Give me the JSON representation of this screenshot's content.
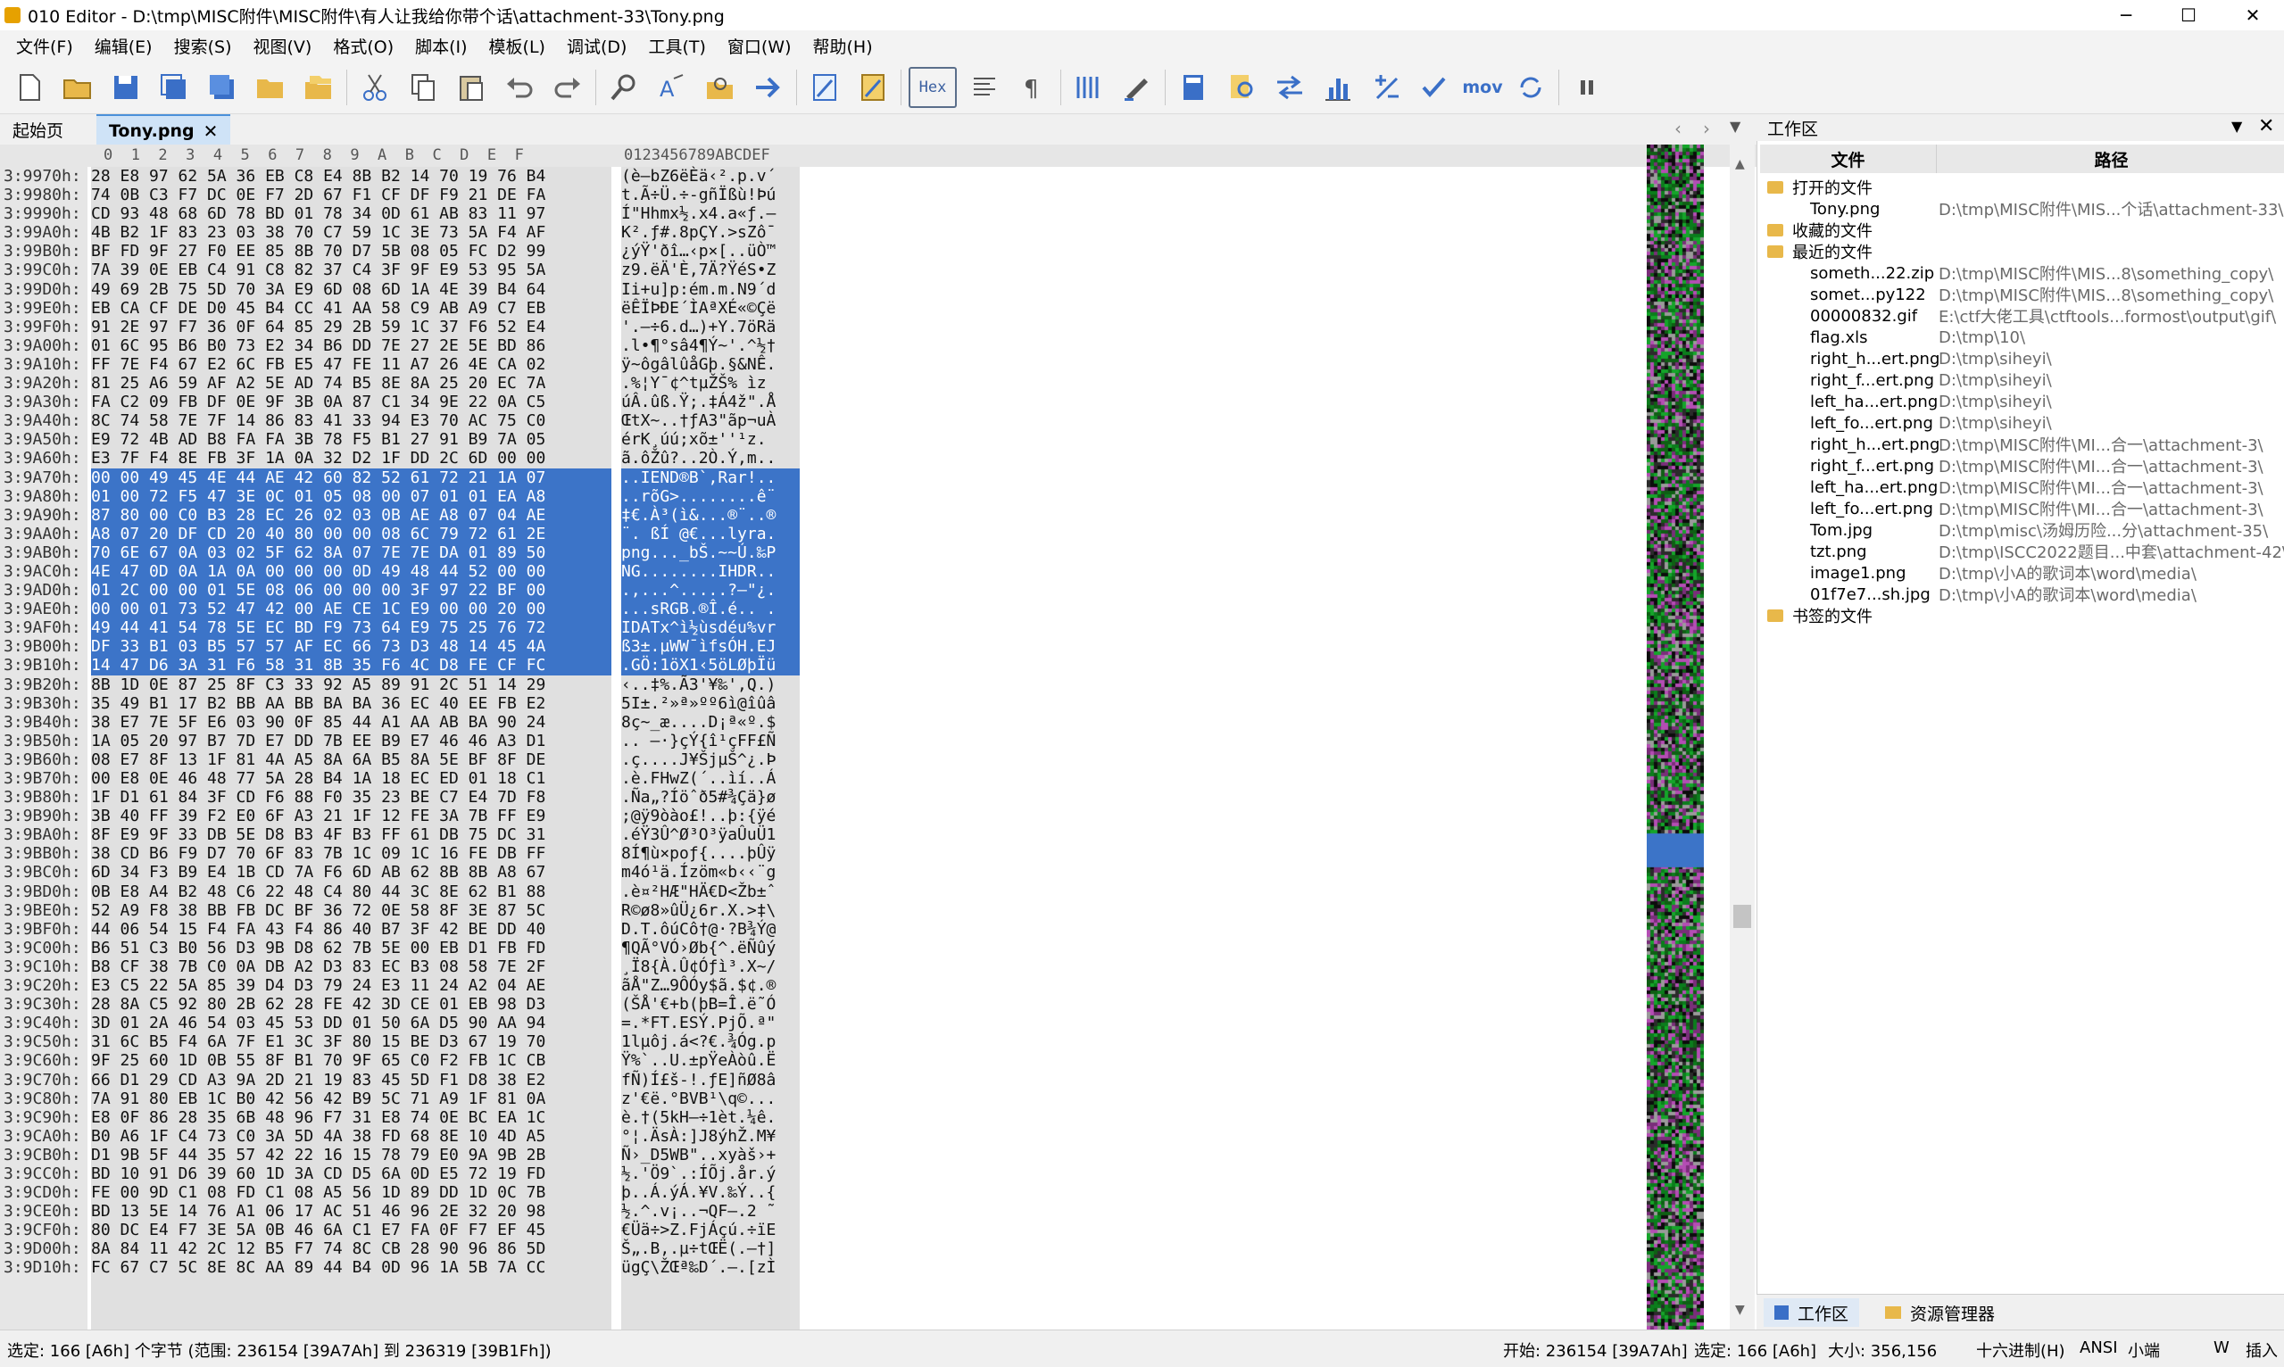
{
  "window": {
    "title": "010 Editor - D:\\tmp\\MISC附件\\MISC附件\\有人让我给你带个话\\attachment-33\\Tony.png",
    "minimize": "─",
    "maximize": "☐",
    "close": "✕"
  },
  "menu": [
    "文件(F)",
    "编辑(E)",
    "搜索(S)",
    "视图(V)",
    "格式(O)",
    "脚本(I)",
    "模板(L)",
    "调试(D)",
    "工具(T)",
    "窗口(W)",
    "帮助(H)"
  ],
  "toolbar": {
    "hex_label": "Hex",
    "mov_label": "mov",
    "icons": [
      "new-file-icon",
      "open-file-icon",
      "save-icon",
      "save-as-icon",
      "save-all-icon",
      "open-folder-icon",
      "workspace-icon",
      "cut-icon",
      "copy-icon",
      "paste-icon",
      "undo-icon",
      "redo-icon",
      "find-icon",
      "replace-icon",
      "find-in-files-icon",
      "goto-icon",
      "template-icon",
      "script-icon",
      "hex-view-icon",
      "line-icon",
      "pilcrow-icon",
      "columns-icon",
      "highlight-icon",
      "calculator-icon",
      "inspector-icon",
      "compare-icon",
      "histogram-icon",
      "arithmetic-icon",
      "checksum-icon",
      "mov-icon",
      "base-convert-icon",
      "pause-icon"
    ]
  },
  "tabs": {
    "start": "起始页",
    "active": "Tony.png",
    "close": "✕"
  },
  "hex_editor": {
    "column_header_hex": "0  1  2  3  4  5  6  7  8  9  A  B  C  D  E  F",
    "column_header_ascii": "0123456789ABCDEF",
    "rows": [
      {
        "addr": "3:9970h:",
        "hex": "28 E8 97 62 5A 36 EB C8 E4 8B B2 14 70 19 76 B4",
        "ascii": "(è—bZ6ëÈä‹².p.v´",
        "sel": false
      },
      {
        "addr": "3:9980h:",
        "hex": "74 0B C3 F7 DC 0E F7 2D 67 F1 CF DF F9 21 DE FA",
        "ascii": "t.Ã÷Ü.÷-gñÏßù!Þú",
        "sel": false
      },
      {
        "addr": "3:9990h:",
        "hex": "CD 93 48 68 6D 78 BD 01 78 34 0D 61 AB 83 11 97",
        "ascii": "Í\"Hhmx½.x4.a«ƒ.—",
        "sel": false
      },
      {
        "addr": "3:99A0h:",
        "hex": "4B B2 1F 83 23 03 38 70 C7 59 1C 3E 73 5A F4 AF",
        "ascii": "K².ƒ#.8pÇY.>sZô¯",
        "sel": false
      },
      {
        "addr": "3:99B0h:",
        "hex": "BF FD 9F 27 F0 EE 85 8B 70 D7 5B 08 05 FC D2 99",
        "ascii": "¿ýŸ'ðî…‹p×[..üÒ™",
        "sel": false
      },
      {
        "addr": "3:99C0h:",
        "hex": "7A 39 0E EB C4 91 C8 82 37 C4 3F 9F E9 53 95 5A",
        "ascii": "z9.ëÄ'È‚7Ä?ŸéS•Z",
        "sel": false
      },
      {
        "addr": "3:99D0h:",
        "hex": "49 69 2B 75 5D 70 3A E9 6D 08 6D 1A 4E 39 B4 64",
        "ascii": "Ii+u]p:ém.m.N9´d",
        "sel": false
      },
      {
        "addr": "3:99E0h:",
        "hex": "EB CA CF DE D0 45 B4 CC 41 AA 58 C9 AB A9 C7 EB",
        "ascii": "ëÊÏÞÐE´ÌAªXÉ«©Çë",
        "sel": false
      },
      {
        "addr": "3:99F0h:",
        "hex": "91 2E 97 F7 36 0F 64 85 29 2B 59 1C 37 F6 52 E4",
        "ascii": "'.—÷6.d…)+Y.7öRä",
        "sel": false
      },
      {
        "addr": "3:9A00h:",
        "hex": "01 6C 95 B6 B0 73 E2 34 B6 DD 7E 27 2E 5E BD 86",
        "ascii": ".l•¶°sâ4¶Ý~'.^½†",
        "sel": false
      },
      {
        "addr": "3:9A10h:",
        "hex": "FF 7E F4 67 E2 6C FB E5 47 FE 11 A7 26 4E CA 02",
        "ascii": "ÿ~ôgâlûåGþ.§&NÊ.",
        "sel": false
      },
      {
        "addr": "3:9A20h:",
        "hex": "81 25 A6 59 AF A2 5E AD 74 B5 8E 8A 25 20 EC 7A",
        "ascii": ".%¦Y¯¢^­tµŽŠ% ìz",
        "sel": false
      },
      {
        "addr": "3:9A30h:",
        "hex": "FA C2 09 FB DF 0E 9F 3B 0A 87 C1 34 9E 22 0A C5",
        "ascii": "úÂ.ûß.Ÿ;.‡Á4ž\".Å",
        "sel": false
      },
      {
        "addr": "3:9A40h:",
        "hex": "8C 74 58 7E 7F 14 86 83 41 33 94 E3 70 AC 75 C0",
        "ascii": "ŒtX~..†ƒA3\"ãp¬uÀ",
        "sel": false
      },
      {
        "addr": "3:9A50h:",
        "hex": "E9 72 4B AD B8 FA FA 3B 78 F5 B1 27 91 B9 7A 05",
        "ascii": "érK­¸úú;xõ±''¹z.",
        "sel": false
      },
      {
        "addr": "3:9A60h:",
        "hex": "E3 7F F4 8E FB 3F 1A 0A 32 D2 1F DD 2C 6D 00 00",
        "ascii": "ã.ôŽû?..2Ò.Ý,m..",
        "sel": false
      },
      {
        "addr": "3:9A70h:",
        "hex": "00 00 49 45 4E 44 AE 42 60 82 52 61 72 21 1A 07",
        "ascii": "..IEND®B`‚Rar!..",
        "sel": true
      },
      {
        "addr": "3:9A80h:",
        "hex": "01 00 72 F5 47 3E 0C 01 05 08 00 07 01 01 EA A8",
        "ascii": "..rõG>........ê¨",
        "sel": true
      },
      {
        "addr": "3:9A90h:",
        "hex": "87 80 00 C0 B3 28 EC 26 02 03 0B AE A8 07 04 AE",
        "ascii": "‡€.À³(ì&...®¨..®",
        "sel": true
      },
      {
        "addr": "3:9AA0h:",
        "hex": "A8 07 20 DF CD 20 40 80 00 00 08 6C 79 72 61 2E",
        "ascii": "¨. ßÍ @€...lyra.",
        "sel": true
      },
      {
        "addr": "3:9AB0h:",
        "hex": "70 6E 67 0A 03 02 5F 62 8A 07 7E 7E DA 01 89 50",
        "ascii": "png..._bŠ.~~Ú.‰P",
        "sel": true
      },
      {
        "addr": "3:9AC0h:",
        "hex": "4E 47 0D 0A 1A 0A 00 00 00 0D 49 48 44 52 00 00",
        "ascii": "NG........IHDR..",
        "sel": true
      },
      {
        "addr": "3:9AD0h:",
        "hex": "01 2C 00 00 01 5E 08 06 00 00 00 3F 97 22 BF 00",
        "ascii": ".,...^.....?—\"¿.",
        "sel": true
      },
      {
        "addr": "3:9AE0h:",
        "hex": "00 00 01 73 52 47 42 00 AE CE 1C E9 00 00 20 00",
        "ascii": "...sRGB.®Î.é.. .",
        "sel": true
      },
      {
        "addr": "3:9AF0h:",
        "hex": "49 44 41 54 78 5E EC BD F9 73 64 E9 75 25 76 72",
        "ascii": "IDATx^ì½ùsdéu%vr",
        "sel": true
      },
      {
        "addr": "3:9B00h:",
        "hex": "DF 33 B1 03 B5 57 57 AF EC 66 73 D3 48 14 45 4A",
        "ascii": "ß3±.µWW¯ìfsÓH.EJ",
        "sel": true
      },
      {
        "addr": "3:9B10h:",
        "hex": "14 47 D6 3A 31 F6 58 31 8B 35 F6 4C D8 FE CF FC",
        "ascii": ".GÖ:1öX1‹5öLØþÏü",
        "sel": true
      },
      {
        "addr": "3:9B20h:",
        "hex": "8B 1D 0E 87 25 8F C3 33 92 A5 89 91 2C 51 14 29",
        "ascii": "‹..‡%.Ã3'¥‰',Q.)",
        "sel": false
      },
      {
        "addr": "3:9B30h:",
        "hex": "35 49 B1 17 B2 BB AA BB BA BA 36 EC 40 EE FB E2",
        "ascii": "5I±.²»ª»ºº6ì@îûâ",
        "sel": false
      },
      {
        "addr": "3:9B40h:",
        "hex": "38 E7 7E 5F E6 03 90 0F 85 44 A1 AA AB BA 90 24",
        "ascii": "8ç~_æ....D¡ª«º.$",
        "sel": false
      },
      {
        "addr": "3:9B50h:",
        "hex": "1A 05 20 97 B7 7D E7 DD 7B EE B9 E7 46 46 A3 D1",
        "ascii": ".. —·}çÝ{î¹çFF£Ñ",
        "sel": false
      },
      {
        "addr": "3:9B60h:",
        "hex": "08 E7 8F 13 1F 81 4A A5 8A 6A B5 8A 5E BF 8F DE",
        "ascii": ".ç....J¥ŠjµŠ^¿.Þ",
        "sel": false
      },
      {
        "addr": "3:9B70h:",
        "hex": "00 E8 0E 46 48 77 5A 28 B4 1A 18 EC ED 01 18 C1",
        "ascii": ".è.FHwZ(´..ìí..Á",
        "sel": false
      },
      {
        "addr": "3:9B80h:",
        "hex": "1F D1 61 84 3F CD F6 88 F0 35 23 BE C7 E4 7D F8",
        "ascii": ".Ña„?Íöˆð5#¾Çä}ø",
        "sel": false
      },
      {
        "addr": "3:9B90h:",
        "hex": "3B 40 FF 39 F2 E0 6F A3 21 1F 12 FE 3A 7B FF E9",
        "ascii": ";@ÿ9òào£!..þ:{ÿé",
        "sel": false
      },
      {
        "addr": "3:9BA0h:",
        "hex": "8F E9 9F 33 DB 5E D8 B3 4F B3 FF 61 DB 75 DC 31",
        "ascii": ".éŸ3Û^Ø³O³ÿaÛuÜ1",
        "sel": false
      },
      {
        "addr": "3:9BB0h:",
        "hex": "38 CD B6 F9 D7 70 6F 83 7B 1C 09 1C 16 FE DB FF",
        "ascii": "8Í¶ù×poƒ{....þÛÿ",
        "sel": false
      },
      {
        "addr": "3:9BC0h:",
        "hex": "6D 34 F3 B9 E4 1B CD 7A F6 6D AB 62 8B 8B A8 67",
        "ascii": "m4ó¹ä.Ízöm«b‹‹¨g",
        "sel": false
      },
      {
        "addr": "3:9BD0h:",
        "hex": "0B E8 A4 B2 48 C6 22 48 C4 80 44 3C 8E 62 B1 88",
        "ascii": ".è¤²HÆ\"HÄ€D<Žb±ˆ",
        "sel": false
      },
      {
        "addr": "3:9BE0h:",
        "hex": "52 A9 F8 38 BB FB DC BF 36 72 0E 58 8F 3E 87 5C",
        "ascii": "R©ø8»ûÜ¿6r.X.>‡\\",
        "sel": false
      },
      {
        "addr": "3:9BF0h:",
        "hex": "44 06 54 15 F4 FA 43 F4 86 40 B7 3F 42 BE DD 40",
        "ascii": "D.T.ôúCô†@·?B¾Ý@",
        "sel": false
      },
      {
        "addr": "3:9C00h:",
        "hex": "B6 51 C3 B0 56 D3 9B D8 62 7B 5E 00 EB D1 FB FD",
        "ascii": "¶QÃ°VÓ›Øb{^.ëÑûý",
        "sel": false
      },
      {
        "addr": "3:9C10h:",
        "hex": "B8 CF 38 7B C0 0A DB A2 D3 83 EC B3 08 58 7E 2F",
        "ascii": "¸Ï8{À.Û¢Óƒì³.X~/",
        "sel": false
      },
      {
        "addr": "3:9C20h:",
        "hex": "E3 C5 22 5A 85 39 D4 D3 79 24 E3 11 24 A2 04 AE",
        "ascii": "ãÅ\"Z…9ÔÓy$ã.$¢.®",
        "sel": false
      },
      {
        "addr": "3:9C30h:",
        "hex": "28 8A C5 92 80 2B 62 28 FE 42 3D CE 01 EB 98 D3",
        "ascii": "(ŠÅ'€+b(þB=Î.ë˜Ó",
        "sel": false
      },
      {
        "addr": "3:9C40h:",
        "hex": "3D 01 2A 46 54 03 45 53 DD 01 50 6A D5 90 AA 94",
        "ascii": "=.*FT.ESÝ.PjÕ.ª\"",
        "sel": false
      },
      {
        "addr": "3:9C50h:",
        "hex": "31 6C B5 F4 6A 7F E1 3C 3F 80 15 BE D3 67 19 70",
        "ascii": "1lµôj.á<?€.¾Óg.p",
        "sel": false
      },
      {
        "addr": "3:9C60h:",
        "hex": "9F 25 60 1D 0B 55 8F B1 70 9F 65 C0 F2 FB 1C CB",
        "ascii": "Ÿ%`..U.±pŸeÀòû.Ë",
        "sel": false
      },
      {
        "addr": "3:9C70h:",
        "hex": "66 D1 29 CD A3 9A 2D 21 19 83 45 5D F1 D8 38 E2",
        "ascii": "fÑ)Í£š-!.ƒE]ñØ8â",
        "sel": false
      },
      {
        "addr": "3:9C80h:",
        "hex": "7A 91 80 EB 1C B0 42 56 42 B9 5C 71 A9 1F 81 0A",
        "ascii": "z'€ë.°BVB¹\\q©...",
        "sel": false
      },
      {
        "addr": "3:9C90h:",
        "hex": "E8 0F 86 28 35 6B 48 96 F7 31 E8 74 0E BC EA 1C",
        "ascii": "è.†(5kH–÷1èt.¼ê.",
        "sel": false
      },
      {
        "addr": "3:9CA0h:",
        "hex": "B0 A6 1F C4 73 C0 3A 5D 4A 38 FD 68 8E 10 4D A5",
        "ascii": "°¦.ÄsÀ:]J8ýhŽ.M¥",
        "sel": false
      },
      {
        "addr": "3:9CB0h:",
        "hex": "D1 9B 5F 44 35 57 42 22 16 15 78 79 E0 9A 9B 2B",
        "ascii": "Ñ›_D5WB\"..xyàš›+",
        "sel": false
      },
      {
        "addr": "3:9CC0h:",
        "hex": "BD 10 91 D6 39 60 1D 3A CD D5 6A 0D E5 72 19 FD",
        "ascii": "½.'Ö9`.:ÍÕj.år.ý",
        "sel": false
      },
      {
        "addr": "3:9CD0h:",
        "hex": "FE 00 9D C1 08 FD C1 08 A5 56 1D 89 DD 1D 0C 7B",
        "ascii": "þ..Á.ýÁ.¥V.‰Ý..{",
        "sel": false
      },
      {
        "addr": "3:9CE0h:",
        "hex": "BD 13 5E 14 76 A1 06 17 AC 51 46 96 2E 32 20 98",
        "ascii": "½.^.v¡..¬QF–.2 ˜",
        "sel": false
      },
      {
        "addr": "3:9CF0h:",
        "hex": "80 DC E4 F7 3E 5A 0B 46 6A C1 E7 FA 0F F7 EF 45",
        "ascii": "€Üä÷>Z.FjÁçú.÷ïE",
        "sel": false
      },
      {
        "addr": "3:9D00h:",
        "hex": "8A 84 11 42 2C 12 B5 F7 74 8C CB 28 90 96 86 5D",
        "ascii": "Š„.B,.µ÷tŒË(.–†]",
        "sel": false
      },
      {
        "addr": "3:9D10h:",
        "hex": "FC 67 C7 5C 8E 8C AA 89 44 B4 0D 96 1A 5B 7A CC",
        "ascii": "ügÇ\\ŽŒª‰D´.–.[zÌ",
        "sel": false
      }
    ]
  },
  "workspace": {
    "title": "工作区",
    "col_file": "文件",
    "col_path": "路径",
    "groups": {
      "open": "打开的文件",
      "favorites": "收藏的文件",
      "recent": "最近的文件",
      "bookmarks": "书签的文件"
    },
    "open_files": [
      {
        "name": "Tony.png",
        "path": "D:\\tmp\\MISC附件\\MIS...个话\\attachment-33\\"
      }
    ],
    "recent_files": [
      {
        "name": "someth...22.zip",
        "path": "D:\\tmp\\MISC附件\\MIS...8\\something_copy\\"
      },
      {
        "name": "somet...py122",
        "path": "D:\\tmp\\MISC附件\\MIS...8\\something_copy\\"
      },
      {
        "name": "00000832.gif",
        "path": "E:\\ctf大佬工具\\ctftools...formost\\output\\gif\\"
      },
      {
        "name": "flag.xls",
        "path": "D:\\tmp\\10\\"
      },
      {
        "name": "right_h...ert.png",
        "path": "D:\\tmp\\siheyi\\"
      },
      {
        "name": "right_f...ert.png",
        "path": "D:\\tmp\\siheyi\\"
      },
      {
        "name": "left_ha...ert.png",
        "path": "D:\\tmp\\siheyi\\"
      },
      {
        "name": "left_fo...ert.png",
        "path": "D:\\tmp\\siheyi\\"
      },
      {
        "name": "right_h...ert.png",
        "path": "D:\\tmp\\MISC附件\\MI...合一\\attachment-3\\"
      },
      {
        "name": "right_f...ert.png",
        "path": "D:\\tmp\\MISC附件\\MI...合一\\attachment-3\\"
      },
      {
        "name": "left_ha...ert.png",
        "path": "D:\\tmp\\MISC附件\\MI...合一\\attachment-3\\"
      },
      {
        "name": "left_fo...ert.png",
        "path": "D:\\tmp\\MISC附件\\MI...合一\\attachment-3\\"
      },
      {
        "name": "Tom.jpg",
        "path": "D:\\tmp\\misc\\汤姆历险...分\\attachment-35\\"
      },
      {
        "name": "tzt.png",
        "path": "D:\\tmp\\ISCC2022题目...中套\\attachment-42\\"
      },
      {
        "name": "image1.png",
        "path": "D:\\tmp\\小A的歌词本\\word\\media\\"
      },
      {
        "name": "01f7e7...sh.jpg",
        "path": "D:\\tmp\\小A的歌词本\\word\\media\\"
      }
    ],
    "bottom_tabs": [
      "工作区",
      "资源管理器"
    ]
  },
  "status": {
    "left": "选定: 166 [A6h] 个字节 (范围: 236154 [39A7Ah] 到 236319 [39B1Fh])",
    "start": "开始: 236154 [39A7Ah]",
    "selected": "选定: 166 [A6h]",
    "size": "大小: 356,156",
    "mode": "十六进制(H)",
    "encoding": "ANSI",
    "endian": "小端",
    "w": "W",
    "insert": "插入"
  },
  "colors": {
    "selection": "#3c74c8",
    "active_tab": "#cfe3f7",
    "accent": "#4a90d9"
  }
}
